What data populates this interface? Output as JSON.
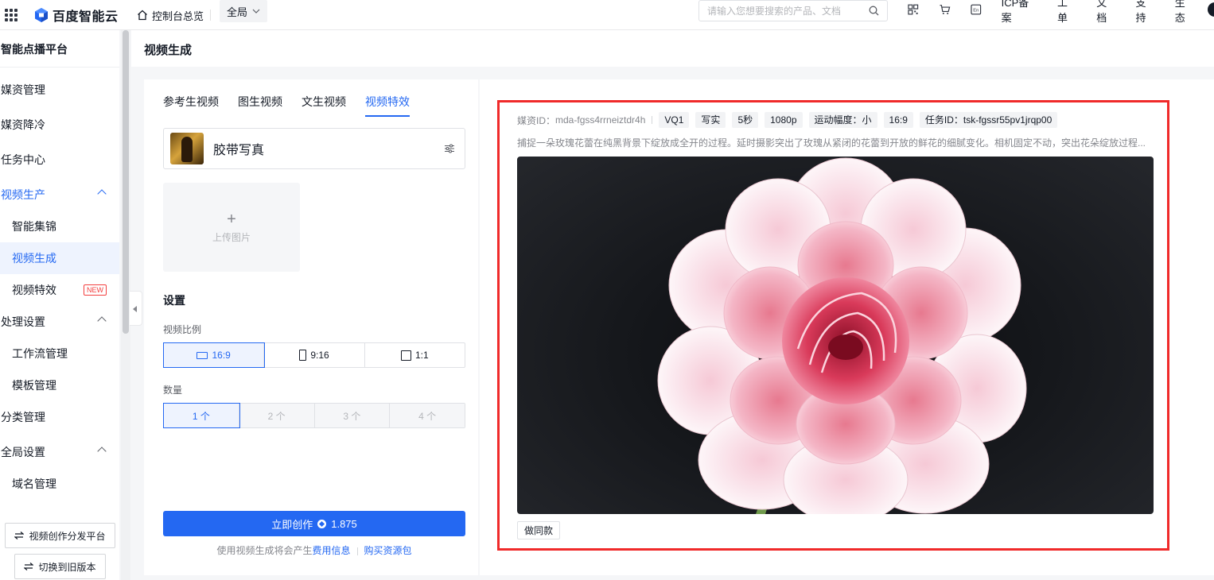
{
  "topbar": {
    "brand": "百度智能云",
    "home_label": "控制台总览",
    "region_label": "全局",
    "search_placeholder": "请输入您想要搜索的产品、文档",
    "links": [
      "ICP备案",
      "工单",
      "文档",
      "支持",
      "生态"
    ],
    "icons": [
      "qrcode-icon",
      "cart-icon",
      "language-icon"
    ]
  },
  "sidebar": {
    "title": "智能点播平台",
    "items": [
      {
        "label": "媒资管理",
        "level": "top"
      },
      {
        "label": "媒资降冷",
        "level": "top"
      },
      {
        "label": "任务中心",
        "level": "top"
      },
      {
        "label": "视频生产",
        "level": "top",
        "expanded": true,
        "active": true
      },
      {
        "label": "智能集锦",
        "level": "sub"
      },
      {
        "label": "视频生成",
        "level": "sub",
        "selected": true
      },
      {
        "label": "视频特效",
        "level": "sub",
        "badge": "NEW"
      },
      {
        "label": "处理设置",
        "level": "top",
        "expanded": true
      },
      {
        "label": "工作流管理",
        "level": "sub"
      },
      {
        "label": "模板管理",
        "level": "sub"
      },
      {
        "label": "分类管理",
        "level": "top"
      },
      {
        "label": "全局设置",
        "level": "top",
        "expanded": true
      },
      {
        "label": "域名管理",
        "level": "sub"
      }
    ],
    "bottom_buttons": [
      "视频创作分发平台",
      "切换到旧版本"
    ]
  },
  "page": {
    "title": "视频生成"
  },
  "left_panel": {
    "tabs": [
      "参考生视频",
      "图生视频",
      "文生视频",
      "视频特效"
    ],
    "active_tab": "视频特效",
    "effect_name": "胶带写真",
    "upload_label": "上传图片",
    "settings_title": "设置",
    "ratio_label": "视频比例",
    "ratios": [
      {
        "label": "16:9",
        "shape": "wide",
        "selected": true
      },
      {
        "label": "9:16",
        "shape": "tall",
        "selected": false
      },
      {
        "label": "1:1",
        "shape": "square",
        "selected": false
      }
    ],
    "count_label": "数量",
    "counts": [
      {
        "label": "1 个",
        "selected": true,
        "disabled": false
      },
      {
        "label": "2 个",
        "selected": false,
        "disabled": true
      },
      {
        "label": "3 个",
        "selected": false,
        "disabled": true
      },
      {
        "label": "4 个",
        "selected": false,
        "disabled": true
      }
    ],
    "create_label": "立即创作",
    "create_cost": "1.875",
    "fee_text": "使用视频生成将会产生",
    "fee_link": "费用信息",
    "buy_link": "购买资源包"
  },
  "result": {
    "media_id_label": "媒资ID：",
    "media_id": "mda-fgss4rrneiztdr4h",
    "tags": [
      "VQ1",
      "写实",
      "5秒",
      "1080p",
      "运动幅度：小",
      "16:9",
      "任务ID：tsk-fgssr55pv1jrqp00"
    ],
    "prompt": "捕捉一朵玫瑰花蕾在纯黑背景下绽放成全开的过程。延时摄影突出了玫瑰从紧闭的花蕾到开放的鲜花的细腻变化。相机固定不动，突出花朵绽放过程...",
    "same_button": "做同款"
  },
  "colors": {
    "accent": "#2468f2",
    "highlight_box": "#f02a2a",
    "new_badge": "#f33e3e"
  }
}
